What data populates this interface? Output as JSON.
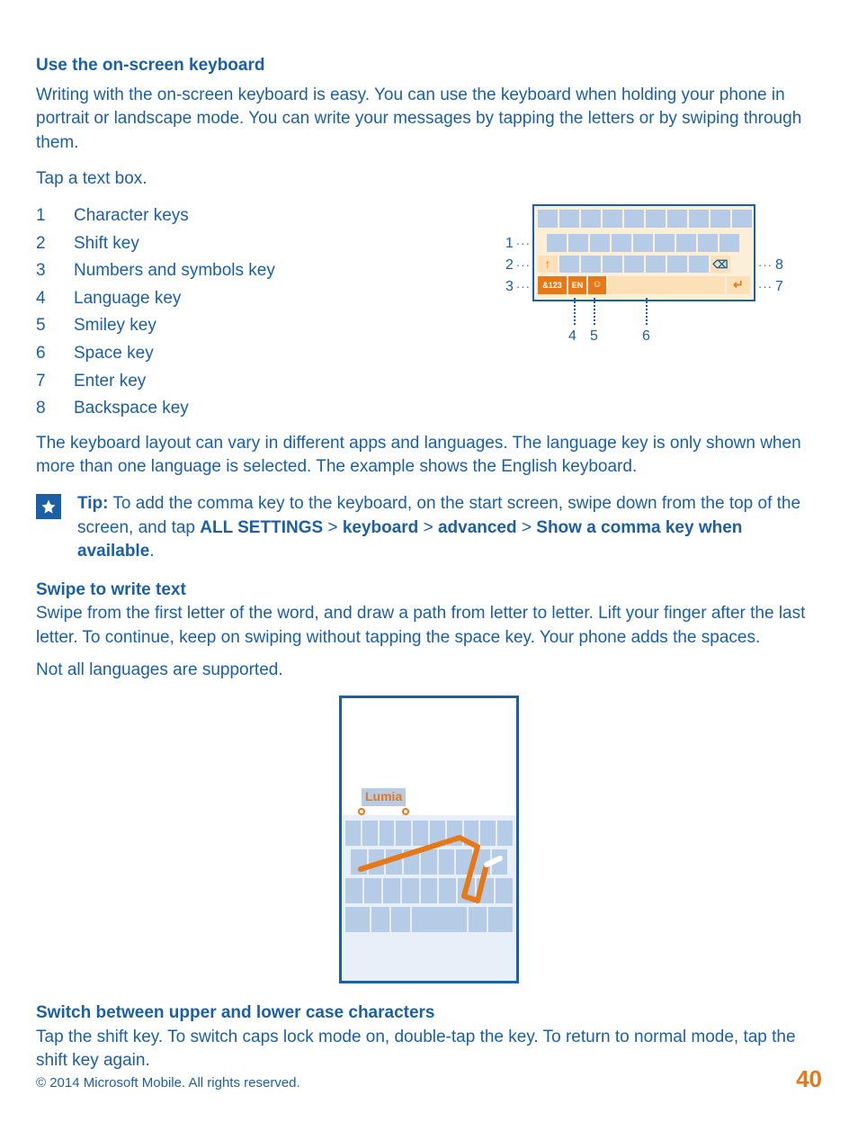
{
  "h1": "Use the on-screen keyboard",
  "intro": "Writing with the on-screen keyboard is easy. You can use the keyboard when holding your phone in portrait or landscape mode. You can write your messages by tapping the letters or by swiping through them.",
  "tap_text": "Tap a text box.",
  "legend": [
    {
      "n": "1",
      "label": "Character keys"
    },
    {
      "n": "2",
      "label": "Shift key"
    },
    {
      "n": "3",
      "label": "Numbers and symbols key"
    },
    {
      "n": "4",
      "label": "Language key"
    },
    {
      "n": "5",
      "label": "Smiley key"
    },
    {
      "n": "6",
      "label": "Space key"
    },
    {
      "n": "7",
      "label": "Enter key"
    },
    {
      "n": "8",
      "label": "Backspace key"
    }
  ],
  "layout_note": "The keyboard layout can vary in different apps and languages. The language key is only shown when more than one language is selected. The example shows the English keyboard.",
  "tip_label": "Tip:",
  "tip_body_pre": " To add the comma key to the keyboard, on the start screen, swipe down from the top of the screen, and tap ",
  "tip_path1": "ALL SETTINGS",
  "tip_gt1": " > ",
  "tip_path2": "keyboard",
  "tip_gt2": " > ",
  "tip_path3": "advanced",
  "tip_gt3": " > ",
  "tip_path4": "Show a comma key when available",
  "tip_period": ".",
  "h2_swipe": "Swipe to write text",
  "swipe_body": "Swipe from the first letter of the word, and draw a path from letter to letter. Lift your finger after the last letter. To continue, keep on swiping without tapping the space key. Your phone adds the spaces.",
  "swipe_note": "Not all languages are supported.",
  "swipe_word": "Lumia",
  "h2_switch": "Switch between upper and lower case characters",
  "switch_body": "Tap the shift key. To switch caps lock mode on, double-tap the key. To return to normal mode, tap the shift key again.",
  "copyright": "© 2014 Microsoft Mobile. All rights reserved.",
  "page_number": "40",
  "kbd": {
    "shift_arrow": "↑",
    "numsym": "&123",
    "lang": "EN",
    "smiley": "☺",
    "backspace": "⌫",
    "enter": "↵",
    "callouts": {
      "c1": "1",
      "c2": "2",
      "c3": "3",
      "c4": "4",
      "c5": "5",
      "c6": "6",
      "c7": "7",
      "c8": "8"
    }
  }
}
